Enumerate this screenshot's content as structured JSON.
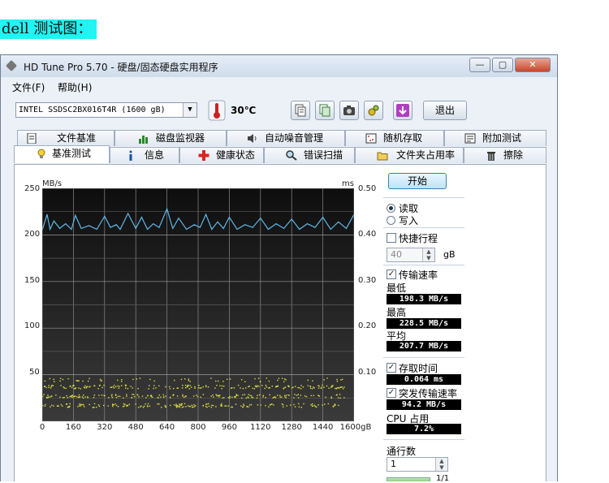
{
  "caption": "dell 测试图：",
  "window": {
    "title": "HD Tune Pro 5.70 - 硬盘/固态硬盘实用程序",
    "controls": {
      "minimize": "—",
      "maximize": "▢",
      "close": "✕"
    }
  },
  "menu": [
    {
      "label": "文件(F)"
    },
    {
      "label": "帮助(H)"
    }
  ],
  "toolbar": {
    "drive": "INTEL SSDSC2BX016T4R (1600 gB)",
    "temperature": "30℃",
    "exit_label": "退出",
    "buttons": [
      "copy-info-icon",
      "copy-screen-icon",
      "camera-icon",
      "settings-icon",
      "download-icon"
    ]
  },
  "tabs": {
    "row1": [
      "文件基准",
      "磁盘监视器",
      "自动噪音管理",
      "随机存取",
      "附加测试"
    ],
    "row2": [
      "基准测试",
      "信息",
      "健康状态",
      "错误扫描",
      "文件夹占用率",
      "擦除"
    ],
    "active": "基准测试"
  },
  "chart_data": {
    "type": "line",
    "title": "",
    "left_unit": "MB/s",
    "right_unit": "ms",
    "xlabel": "gB",
    "x_ticks": [
      "0",
      "160",
      "320",
      "480",
      "640",
      "800",
      "960",
      "1120",
      "1280",
      "1440",
      "1600gB"
    ],
    "y_ticks_left": [
      "250",
      "200",
      "150",
      "100",
      "50"
    ],
    "y_ticks_right": [
      "0.50",
      "0.40",
      "0.30",
      "0.20",
      "0.10"
    ],
    "xlim": [
      0,
      1600
    ],
    "ylim_left": [
      0,
      250
    ],
    "ylim_right": [
      0,
      0.5
    ],
    "grid": true,
    "background": "#1c1c1c",
    "series": [
      {
        "kind": "transfer-rate",
        "color": "#5fb8e8",
        "x": [
          0,
          25,
          40,
          60,
          90,
          120,
          150,
          170,
          200,
          240,
          280,
          320,
          350,
          380,
          400,
          440,
          480,
          510,
          540,
          570,
          600,
          640,
          670,
          700,
          740,
          780,
          810,
          840,
          870,
          900,
          930,
          960,
          1000,
          1040,
          1080,
          1120,
          1160,
          1200,
          1240,
          1280,
          1320,
          1360,
          1400,
          1440,
          1480,
          1520,
          1560,
          1600
        ],
        "y": [
          205,
          222,
          206,
          215,
          207,
          212,
          206,
          221,
          207,
          210,
          206,
          220,
          208,
          211,
          206,
          223,
          207,
          219,
          206,
          212,
          208,
          228,
          207,
          218,
          206,
          211,
          208,
          222,
          206,
          214,
          207,
          219,
          206,
          211,
          208,
          218,
          206,
          212,
          207,
          217,
          206,
          212,
          208,
          219,
          206,
          214,
          207,
          222
        ]
      },
      {
        "kind": "access-time",
        "color": "#e0e040",
        "bands_ms": [
          0.035,
          0.055,
          0.075,
          0.09
        ],
        "x_range": [
          0,
          1560
        ]
      }
    ]
  },
  "side": {
    "start_label": "开始",
    "read_label": "读取",
    "write_label": "写入",
    "short_stroke_label": "快捷行程",
    "short_stroke_value": "40",
    "short_stroke_unit": "gB",
    "transfer_rate_label": "传输速率",
    "min_label": "最低",
    "min_value": "198.3 MB/s",
    "max_label": "最高",
    "max_value": "228.5 MB/s",
    "avg_label": "平均",
    "avg_value": "207.7 MB/s",
    "access_time_label": "存取时间",
    "access_time_value": "0.064 ms",
    "burst_label": "突发传输速率",
    "burst_value": "94.2 MB/s",
    "cpu_label": "CPU 占用",
    "cpu_value": "7.2%",
    "passes_label": "通行数",
    "passes_value": "1",
    "progress_text": "1/1"
  }
}
